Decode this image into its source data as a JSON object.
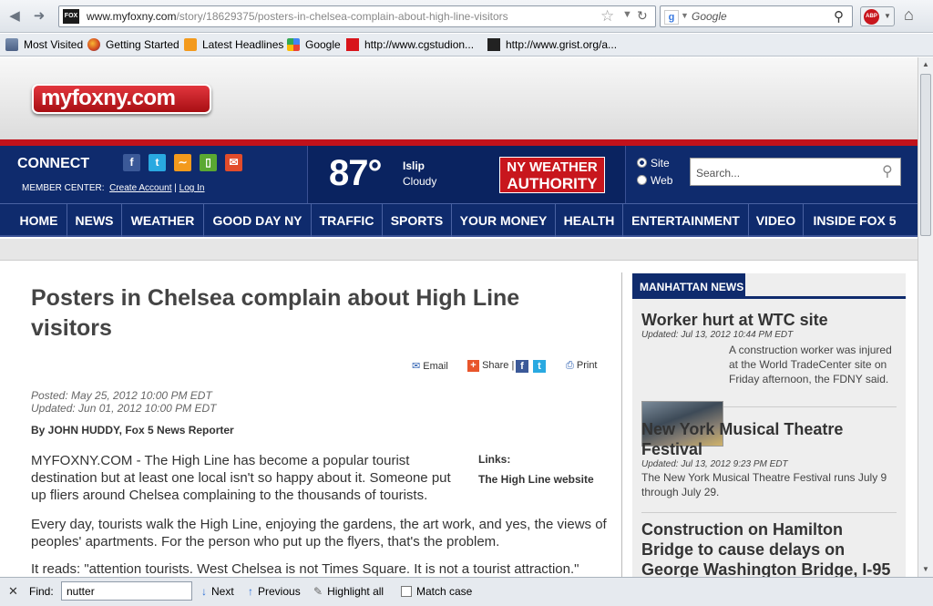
{
  "browser": {
    "url_host": "www.myfoxny.com",
    "url_path": "/story/18629375/posters-in-chelsea-complain-about-high-line-visitors",
    "favicon_text": "FOX",
    "search_placeholder": "Google",
    "abp_label": "ABP",
    "bookmarks": [
      {
        "label": "Most Visited",
        "icon": "bookmarks-folder-icon"
      },
      {
        "label": "Getting Started",
        "icon": "firefox-icon"
      },
      {
        "label": "Latest Headlines",
        "icon": "rss-icon"
      },
      {
        "label": "Google",
        "icon": "google-icon"
      },
      {
        "label": "http://www.cgstudion...",
        "icon": "red-square-icon"
      },
      {
        "label": "http://www.grist.org/a...",
        "icon": "grist-icon"
      }
    ]
  },
  "site": {
    "logo": "myfoxny.com",
    "connect": {
      "title": "CONNECT",
      "member_label": "MEMBER CENTER:",
      "create_account": "Create Account",
      "separator": "|",
      "login": "Log In",
      "social_icons": [
        "facebook-icon",
        "twitter-icon",
        "rss-icon",
        "mobile-icon",
        "email-icon"
      ]
    },
    "weather": {
      "temp": "87°",
      "location": "Islip",
      "condition": "Cloudy",
      "brand_line1": "NY WEATHER",
      "brand_line2": "AUTHORITY"
    },
    "search": {
      "option_site": "Site",
      "option_web": "Web",
      "selected": "Site",
      "placeholder": "Search..."
    },
    "nav": [
      "HOME",
      "NEWS",
      "WEATHER",
      "GOOD DAY NY",
      "TRAFFIC",
      "SPORTS",
      "YOUR MONEY",
      "HEALTH",
      "ENTERTAINMENT",
      "VIDEO",
      "INSIDE FOX 5"
    ]
  },
  "article": {
    "title": "Posters in Chelsea complain about High Line visitors",
    "tools": {
      "email": "Email",
      "share": "Share",
      "sep": "|",
      "print": "Print"
    },
    "posted": "Posted: May 25, 2012 10:00 PM EDT",
    "updated": "Updated: Jun 01, 2012 10:00 PM EDT",
    "byline": "By JOHN HUDDY, Fox 5 News Reporter",
    "links_label": "Links:",
    "link1": "The High Line website",
    "para1": "MYFOXNY.COM - The High Line has become a popular tourist destination but at least one local isn't so happy about it. Someone put up fliers around Chelsea complaining to the thousands of tourists.",
    "para2": "Every day, tourists walk the High Line, enjoying the gardens, the art work, and yes, the views of peoples' apartments. For the person who put up the flyers, that's the problem.",
    "para3": "It reads: \"attention tourists. West Chelsea is not Times Square. It is not a tourist attraction.\""
  },
  "sidebar": {
    "heading": "MANHATTAN NEWS",
    "stories": [
      {
        "title": "Worker hurt at WTC site",
        "updated": "Updated: Jul 13, 2012 10:44 PM EDT",
        "summary": "A construction worker was injured at the World TradeCenter site on Friday afternoon, the FDNY said."
      },
      {
        "title": "New York Musical Theatre Festival",
        "updated": "Updated: Jul 13, 2012 9:23 PM EDT",
        "summary": "The New York Musical Theatre Festival runs July 9 through July 29."
      },
      {
        "title": "Construction on Hamilton Bridge to cause delays on George Washington Bridge, I-95",
        "updated": "",
        "summary": ""
      }
    ]
  },
  "findbar": {
    "label": "Find:",
    "value": "nutter",
    "next": "Next",
    "previous": "Previous",
    "highlight": "Highlight all",
    "match_case": "Match case"
  }
}
